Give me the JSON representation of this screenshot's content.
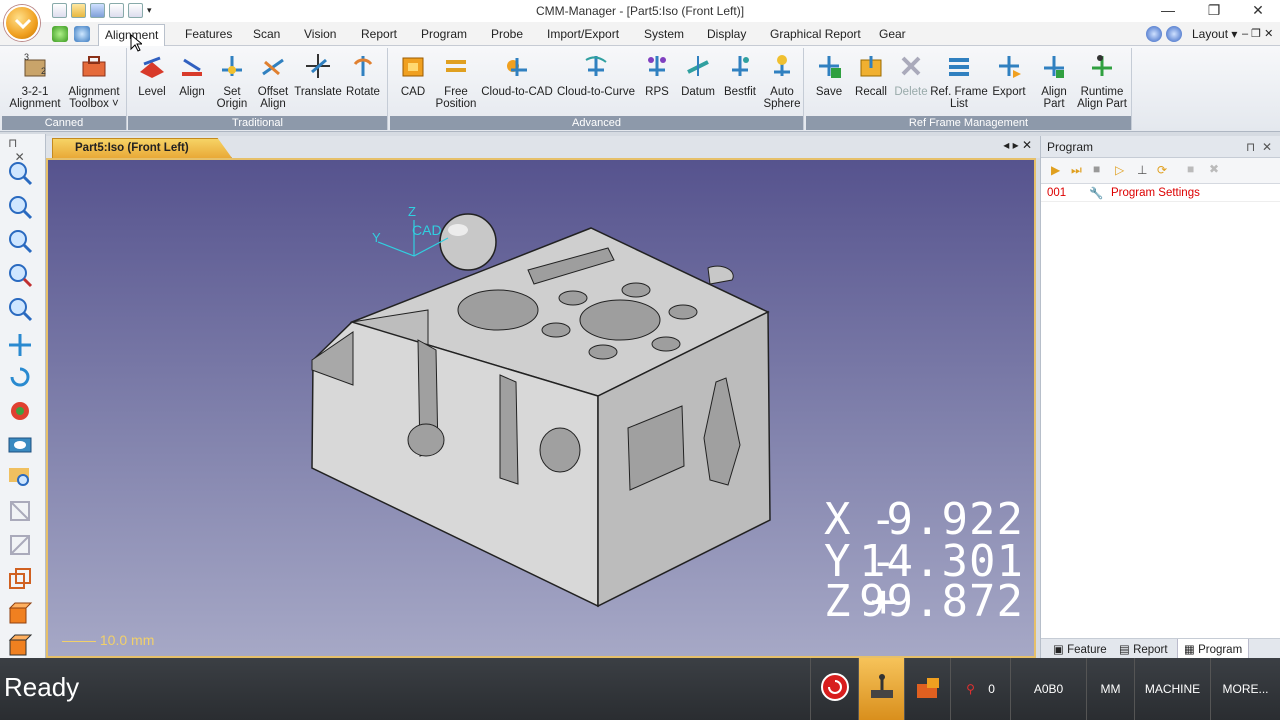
{
  "window": {
    "title": "CMM-Manager - [Part5:Iso (Front Left)]",
    "controls": [
      "—",
      "❐",
      "✕"
    ]
  },
  "tabs": [
    "Alignment",
    "Features",
    "Scan",
    "Vision",
    "Report",
    "Program",
    "Probe",
    "Import/Export",
    "System",
    "Display",
    "Graphical Report",
    "Gear"
  ],
  "layout_menu": "Layout",
  "ribbon": {
    "groups": [
      {
        "label": "Canned",
        "buttons": [
          [
            "3-2-1",
            "Alignment"
          ],
          [
            "Alignment",
            "Toolbox ˅"
          ]
        ]
      },
      {
        "label": "Traditional",
        "buttons": [
          [
            "Level",
            ""
          ],
          [
            "Align",
            ""
          ],
          [
            "Set",
            "Origin"
          ],
          [
            "Offset",
            "Align"
          ],
          [
            "Translate",
            ""
          ],
          [
            "Rotate",
            ""
          ]
        ]
      },
      {
        "label": "Advanced",
        "buttons": [
          [
            "CAD",
            ""
          ],
          [
            "Free",
            "Position"
          ],
          [
            "Cloud-to-CAD",
            ""
          ],
          [
            "Cloud-to-Curve",
            ""
          ],
          [
            "RPS",
            ""
          ],
          [
            "Datum",
            ""
          ],
          [
            "Bestfit",
            ""
          ],
          [
            "Auto",
            "Sphere"
          ]
        ]
      },
      {
        "label": "Ref Frame Management",
        "buttons": [
          [
            "Save",
            ""
          ],
          [
            "Recall",
            ""
          ],
          [
            "Delete",
            ""
          ],
          [
            "Ref. Frame",
            "List"
          ],
          [
            "Export",
            ""
          ],
          [
            "Align",
            "Part"
          ],
          [
            "Runtime",
            "Align Part"
          ]
        ]
      }
    ]
  },
  "viewport": {
    "tab_label": "Part5:Iso (Front Left)",
    "axis_labels": {
      "z": "Z",
      "y": "Y",
      "cad": "CAD"
    },
    "readout": {
      "x": {
        "axis": "X",
        "sign": "-",
        "value": "9.922"
      },
      "y": {
        "axis": "Y",
        "sign": "-",
        "value": "14.301"
      },
      "z": {
        "axis": "Z",
        "sign": "+",
        "value": "99.872"
      }
    },
    "scale": "10.0 mm"
  },
  "program_panel": {
    "title": "Program",
    "rows": [
      {
        "num": "001",
        "label": "Program Settings"
      }
    ],
    "bottom_tabs": [
      "Feature",
      "Report",
      "Program"
    ]
  },
  "status": {
    "ready": "Ready",
    "probe_count": "0",
    "cells": [
      "A0B0",
      "MM",
      "MACHINE",
      "MORE..."
    ]
  },
  "colors": {
    "accent": "#e9a937",
    "viewport_top": "#56538e",
    "program_text": "#dd0000",
    "status_bg": "#2a2d31"
  }
}
